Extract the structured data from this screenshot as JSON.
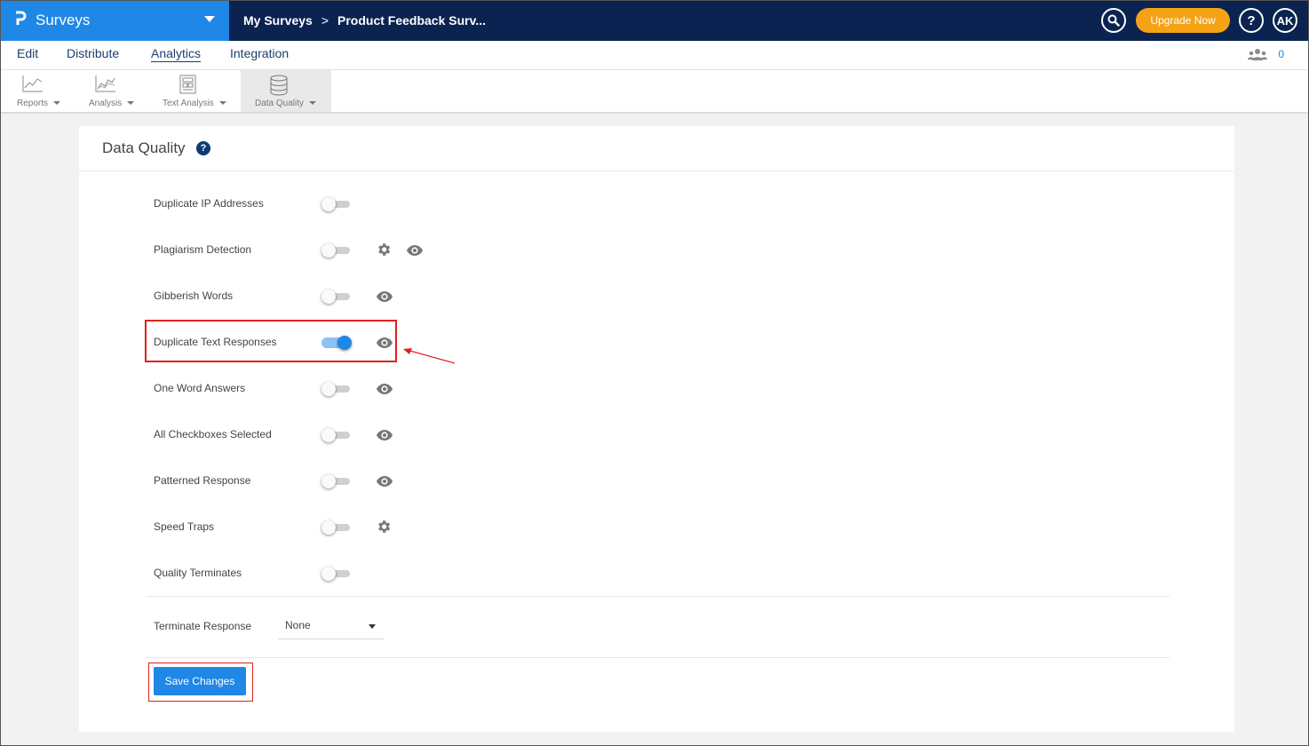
{
  "header": {
    "brand": "Surveys",
    "breadcrumbs": [
      "My Surveys",
      "Product Feedback Surv..."
    ],
    "breadcrumb_separator": ">",
    "upgrade_label": "Upgrade Now",
    "help_label": "?",
    "avatar_initials": "AK"
  },
  "nav": {
    "items": [
      "Edit",
      "Distribute",
      "Analytics",
      "Integration"
    ],
    "active": "Analytics",
    "collaborators_count": "0"
  },
  "toolbar": {
    "items": [
      {
        "label": "Reports",
        "icon": "line-chart-icon"
      },
      {
        "label": "Analysis",
        "icon": "area-chart-icon"
      },
      {
        "label": "Text Analysis",
        "icon": "document-grid-icon"
      },
      {
        "label": "Data Quality",
        "icon": "database-icon",
        "active": true
      }
    ]
  },
  "panel": {
    "title": "Data Quality",
    "rows": [
      {
        "label": "Duplicate IP Addresses",
        "enabled": false,
        "settings": false,
        "preview": false
      },
      {
        "label": "Plagiarism Detection",
        "enabled": false,
        "settings": true,
        "preview": true
      },
      {
        "label": "Gibberish Words",
        "enabled": false,
        "settings": false,
        "preview": true
      },
      {
        "label": "Duplicate Text Responses",
        "enabled": true,
        "settings": false,
        "preview": true
      },
      {
        "label": "One Word Answers",
        "enabled": false,
        "settings": false,
        "preview": true
      },
      {
        "label": "All Checkboxes Selected",
        "enabled": false,
        "settings": false,
        "preview": true
      },
      {
        "label": "Patterned Response",
        "enabled": false,
        "settings": false,
        "preview": true
      },
      {
        "label": "Speed Traps",
        "enabled": false,
        "settings": true,
        "preview": false
      },
      {
        "label": "Quality Terminates",
        "enabled": false,
        "settings": false,
        "preview": false
      }
    ],
    "terminate_label": "Terminate Response",
    "terminate_value": "None",
    "save_label": "Save Changes"
  },
  "colors": {
    "brand_blue": "#1f87e5",
    "header_navy": "#0b2350",
    "upgrade_orange": "#f5a314",
    "highlight_red": "#e0201c"
  }
}
